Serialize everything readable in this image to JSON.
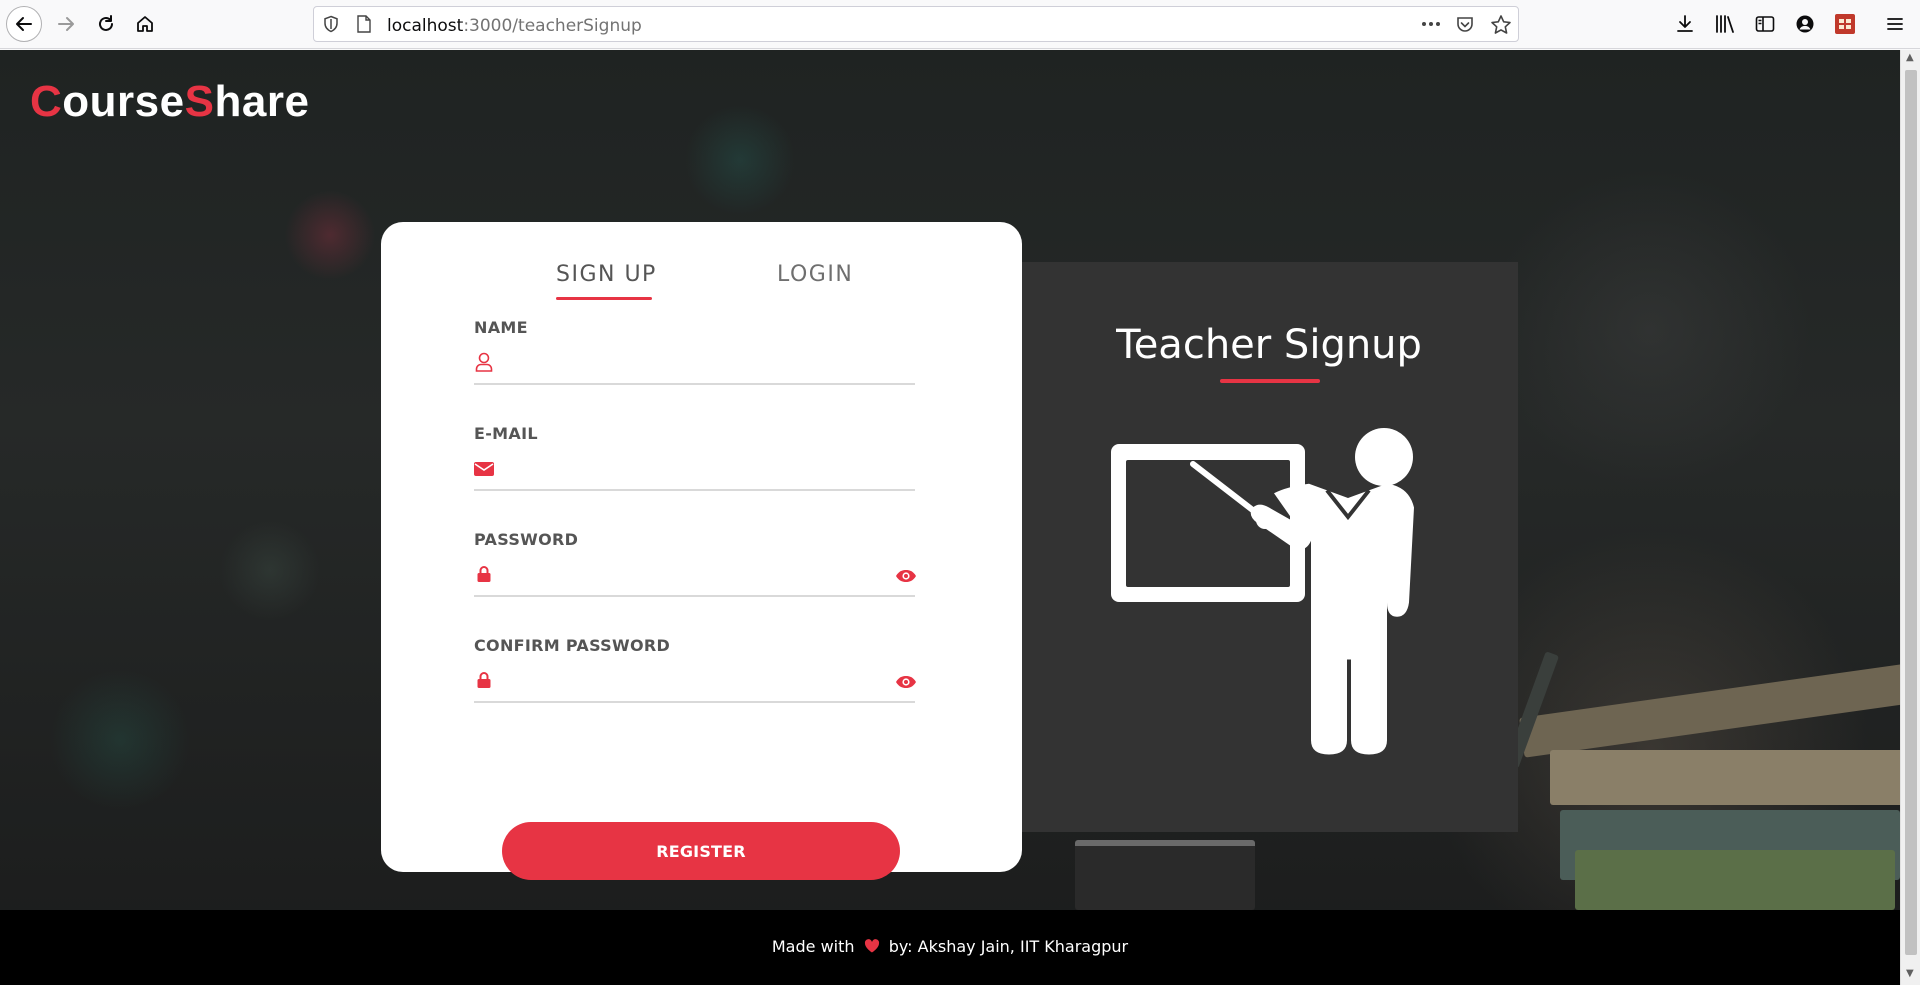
{
  "browser": {
    "url_host": "localhost",
    "url_path": ":3000/teacherSignup",
    "icons": {
      "back": "back-arrow-icon",
      "forward": "forward-arrow-icon",
      "reload": "reload-icon",
      "home": "home-icon",
      "shield": "shield-icon",
      "page": "page-icon",
      "more": "more-dots-icon",
      "pocket": "pocket-icon",
      "bookmark": "star-icon",
      "downloads": "download-icon",
      "library": "library-icon",
      "sidebar": "sidebar-icon",
      "account": "account-icon",
      "extension": "extension-icon",
      "menu": "hamburger-menu-icon"
    }
  },
  "brand": {
    "c": "C",
    "ourse": "ourse",
    "s": "S",
    "hare": "hare"
  },
  "tabs": {
    "signup": "SIGN UP",
    "login": "LOGIN",
    "active": "signup"
  },
  "form": {
    "name_label": "NAME",
    "email_label": "E-MAIL",
    "password_label": "PASSWORD",
    "confirm_label": "CONFIRM PASSWORD",
    "name_value": "",
    "email_value": "",
    "password_value": "",
    "confirm_value": "",
    "register_label": "REGISTER"
  },
  "panel": {
    "title": "Teacher Signup",
    "illustration": "teacher-at-blackboard-icon"
  },
  "footer": {
    "prefix": "Made with",
    "suffix": "by: Akshay Jain, IIT Kharagpur",
    "heart_icon": "heart-icon"
  },
  "colors": {
    "accent": "#e73444",
    "panel_bg": "#333333",
    "footer_bg": "#000000",
    "card_bg": "#ffffff"
  }
}
